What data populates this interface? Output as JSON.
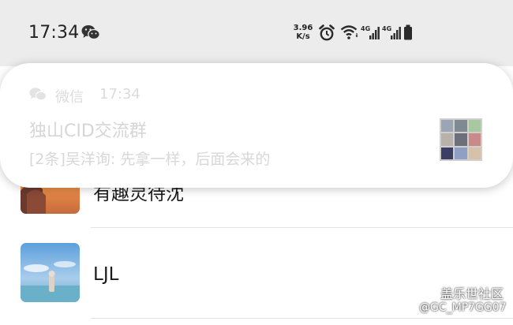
{
  "status_bar": {
    "time": "17:34",
    "net_speed_value": "3.96",
    "net_speed_unit": "K/s",
    "signal_labels": [
      "4G",
      "4G"
    ]
  },
  "notification": {
    "app_name": "微信",
    "time": "17:34",
    "title": "独山CID交流群",
    "message": "[2条]吴洋询: 先拿一样，后面会来的"
  },
  "chat_list": {
    "items": [
      {
        "name": "有趣灵待沈"
      },
      {
        "name": "LJL"
      }
    ]
  },
  "watermark": {
    "title": "盖乐世社区",
    "user": "@GC_MP7GG07"
  }
}
